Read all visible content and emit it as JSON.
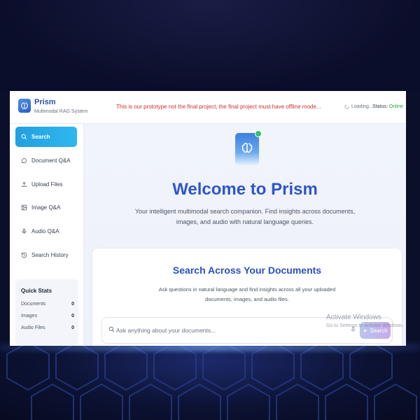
{
  "header": {
    "app_name": "Prism",
    "app_subtitle": "Multimodal RAG System",
    "notice": "This is our prototype not the final project, the final project must have offline mode...",
    "loading_text": "Loading...",
    "status_label": "Status:",
    "status_value": "Online"
  },
  "sidebar": {
    "items": [
      {
        "label": "Search",
        "icon": "search-icon",
        "active": true
      },
      {
        "label": "Document Q&A",
        "icon": "chat-bubble-icon"
      },
      {
        "label": "Upload Files",
        "icon": "upload-icon"
      },
      {
        "label": "Image Q&A",
        "icon": "image-icon"
      },
      {
        "label": "Audio Q&A",
        "icon": "microphone-icon"
      },
      {
        "label": "Search History",
        "icon": "history-icon"
      }
    ],
    "quick_stats": {
      "title": "Quick Stats",
      "rows": [
        {
          "label": "Documents",
          "value": "0"
        },
        {
          "label": "Images",
          "value": "0"
        },
        {
          "label": "Audio Files",
          "value": "0"
        }
      ]
    }
  },
  "main": {
    "welcome_title": "Welcome to Prism",
    "tagline": "Your intelligent multimodal search companion. Find insights across documents, images, and audio with natural language queries.",
    "card": {
      "title": "Search Across Your Documents",
      "description": "Ask questions in natural language and find insights across all your uploaded documents, images, and audio files.",
      "search_placeholder": "Ask anything about your documents...",
      "search_button": "Search"
    }
  },
  "overlay": {
    "watermark_title": "Activate Windows",
    "watermark_sub": "Go to Settings to activate Windows."
  },
  "colors": {
    "accent": "#2f56c8",
    "active_nav": "#20a0e0",
    "notice": "#d12f2f",
    "online": "#22a34a"
  }
}
